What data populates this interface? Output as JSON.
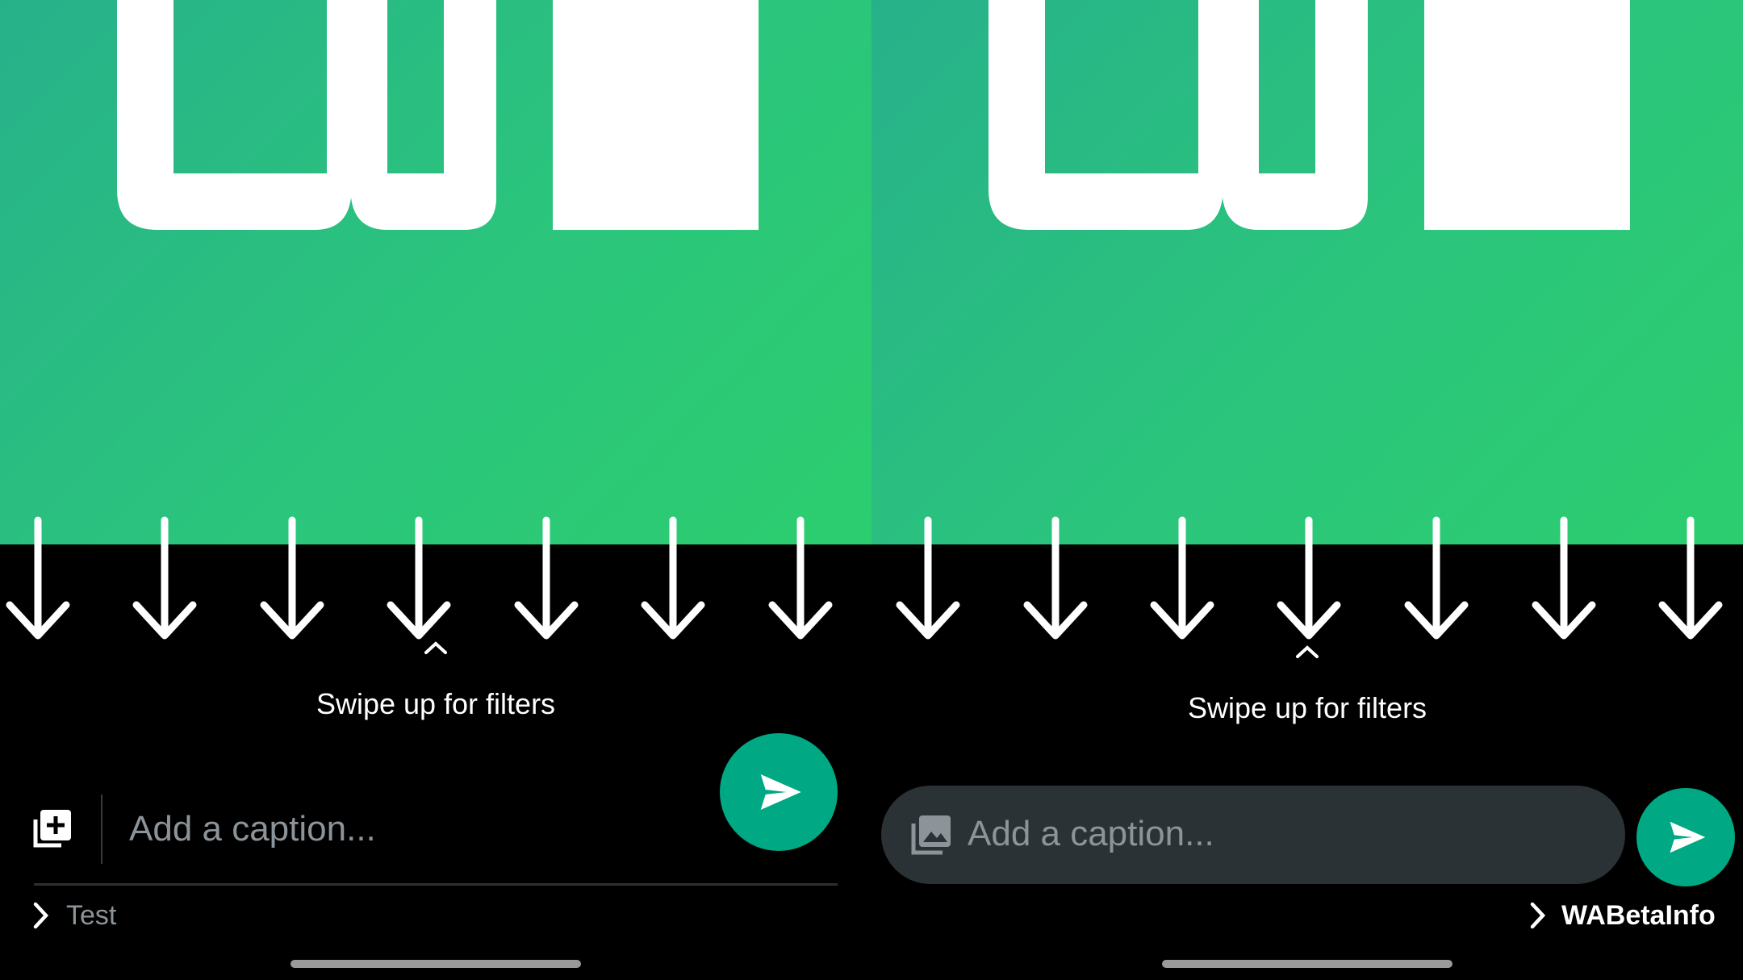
{
  "left": {
    "preview_label": "WBI",
    "filter_hint": "Swipe up for filters",
    "caption": {
      "placeholder": "Add a caption..."
    },
    "recipient": "Test",
    "icons": {
      "add_media": "add-media-icon",
      "send": "send-icon",
      "chevron": "chevron-right-icon"
    }
  },
  "right": {
    "preview_label": "WBI",
    "filter_hint": "Swipe up for filters",
    "caption": {
      "placeholder": "Add a caption..."
    },
    "recipient": "WABetaInfo",
    "icons": {
      "gallery": "gallery-icon",
      "send": "send-icon",
      "chevron": "chevron-right-icon"
    }
  },
  "colors": {
    "accent": "#00a884",
    "preview_green": "#2bc57c",
    "caption_pill": "#2b3236"
  }
}
